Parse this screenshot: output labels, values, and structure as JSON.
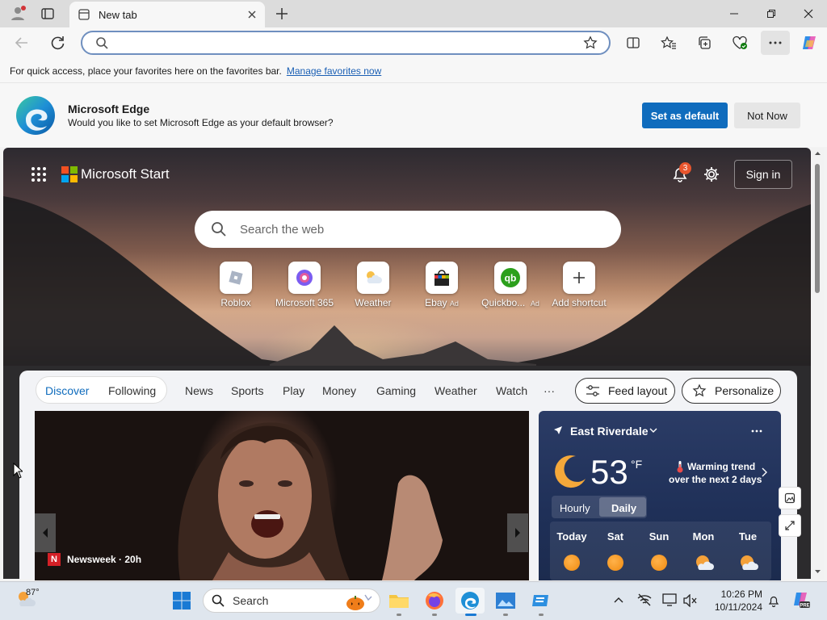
{
  "browser": {
    "tab_title": "New tab",
    "address_value": "",
    "favorites_hint": "For quick access, place your favorites here on the favorites bar.",
    "manage_favorites": "Manage favorites now"
  },
  "infobar": {
    "title": "Microsoft Edge",
    "message": "Would you like to set Microsoft Edge as your default browser?",
    "set_default": "Set as default",
    "not_now": "Not Now"
  },
  "start": {
    "brand": "Microsoft Start",
    "notification_count": "3",
    "sign_in": "Sign in",
    "search_placeholder": "Search the web",
    "shortcuts": [
      {
        "label": "Roblox",
        "ad": ""
      },
      {
        "label": "Microsoft 365",
        "ad": ""
      },
      {
        "label": "Weather",
        "ad": ""
      },
      {
        "label": "Ebay",
        "ad": "Ad"
      },
      {
        "label": "Quickbo...",
        "ad": "Ad"
      },
      {
        "label": "Add shortcut",
        "ad": ""
      }
    ]
  },
  "feed": {
    "tabs": [
      "Discover",
      "Following"
    ],
    "nav": [
      "News",
      "Sports",
      "Play",
      "Money",
      "Gaming",
      "Weather",
      "Watch",
      "···"
    ],
    "feed_layout": "Feed layout",
    "personalize": "Personalize",
    "hero_source": "Newsweek · 20h"
  },
  "weather": {
    "location": "East Riverdale",
    "temp": "53",
    "unit": "°F",
    "trend_line1": "Warming trend",
    "trend_line2": "over the next 2 days",
    "toggle": [
      "Hourly",
      "Daily"
    ],
    "days": [
      "Today",
      "Sat",
      "Sun",
      "Mon",
      "Tue"
    ]
  },
  "taskbar": {
    "weather_temp": "87°",
    "search_label": "Search",
    "time": "10:26 PM",
    "date": "10/11/2024"
  },
  "colors": {
    "accent": "#0f6cbd",
    "link": "#1a5fb4",
    "feed_active": "#0f6cbd",
    "weather_bg": "#1f3058"
  }
}
